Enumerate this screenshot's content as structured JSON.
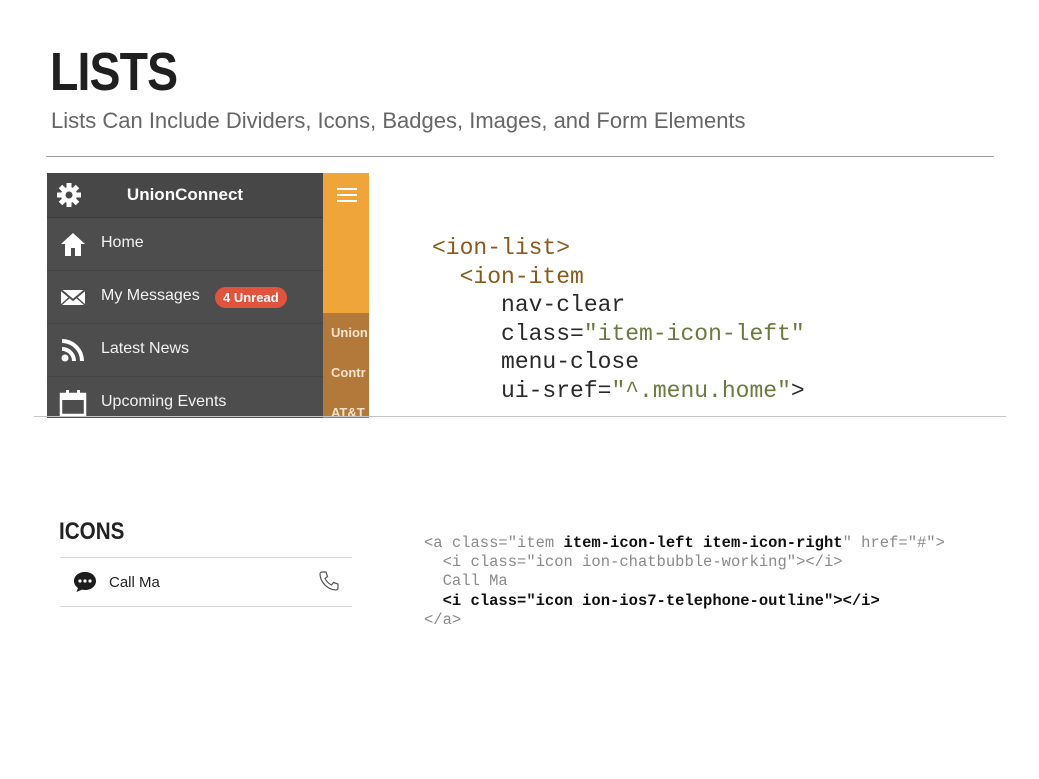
{
  "page": {
    "title": "LISTS",
    "subtitle": "Lists Can Include Dividers, Icons, Badges, Images, and Form Elements"
  },
  "app": {
    "header_title": "UnionConnect",
    "menu_items": [
      {
        "label": "Home",
        "icon": "home-icon"
      },
      {
        "label": "My Messages",
        "icon": "envelope-icon",
        "badge": "4 Unread"
      },
      {
        "label": "Latest News",
        "icon": "rss-icon"
      },
      {
        "label": "Upcoming Events",
        "icon": "calendar-icon"
      }
    ],
    "side_items": [
      "Union",
      "Contr",
      "AT&T"
    ],
    "colors": {
      "menu_bg": "#4d4d4d",
      "accent": "#f0a53a",
      "badge": "#e0533d"
    }
  },
  "code_block_1": {
    "line1_tag": "<ion-list>",
    "line2_tag": "<ion-item",
    "line3": "nav-clear",
    "line4_attr": "class=",
    "line4_value": "\"item-icon-left\"",
    "line5": "menu-close",
    "line6_attr": "ui-sref=",
    "line6_value": "\"^.menu.home\"",
    "line6_end": ">"
  },
  "icons_section": {
    "title": "ICONS",
    "item_label": "Call Ma"
  },
  "code_block_2": {
    "line1_a": "<a class=\"item ",
    "line1_b": "item-icon-left item-icon-right",
    "line1_c": "\" href=\"#\">",
    "line2": "<i class=\"icon ion-chatbubble-working\"></i>",
    "line3": "Call Ma",
    "line4": "<i class=\"icon ion-ios7-telephone-outline\"></i>",
    "line5": "</a>"
  }
}
